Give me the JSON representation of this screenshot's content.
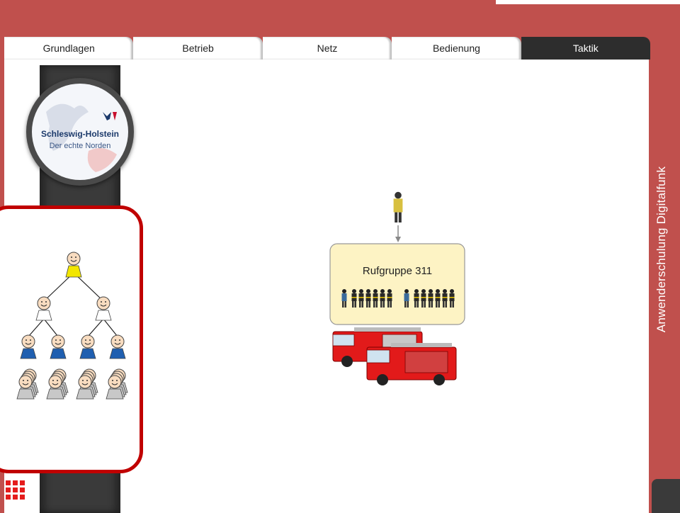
{
  "nav": {
    "tabs": [
      {
        "label": "Grundlagen",
        "active": false
      },
      {
        "label": "Betrieb",
        "active": false
      },
      {
        "label": "Netz",
        "active": false
      },
      {
        "label": "Bedienung",
        "active": false
      },
      {
        "label": "Taktik",
        "active": true
      }
    ]
  },
  "sidebar": {
    "title": "Anwenderschulung Digitalfunk"
  },
  "logo": {
    "line1": "Schleswig-Holstein",
    "line2": "Der echte Norden"
  },
  "diagram": {
    "group_label": "Rufgruppe 311"
  },
  "colors": {
    "frame": "#c0504d",
    "active_tab": "#2d2d2d",
    "panel_border": "#c00000",
    "group_box": "#fdf3c4"
  },
  "icons": {
    "menu": "grid-icon"
  }
}
